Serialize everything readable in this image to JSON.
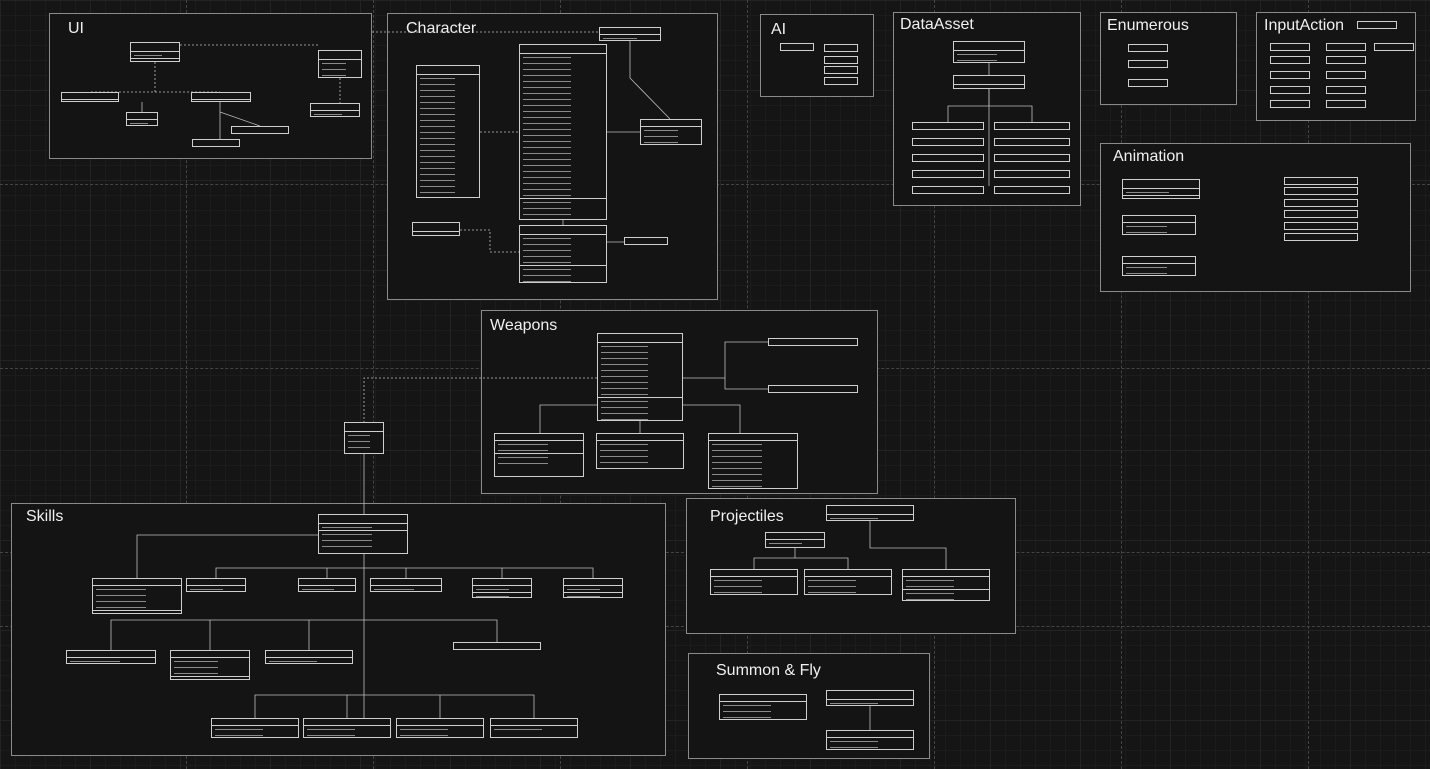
{
  "frames": [
    {
      "id": "ui",
      "title": "UI"
    },
    {
      "id": "character",
      "title": "Character"
    },
    {
      "id": "ai",
      "title": "AI"
    },
    {
      "id": "dataasset",
      "title": "DataAsset"
    },
    {
      "id": "enumerous",
      "title": "Enumerous"
    },
    {
      "id": "inputaction",
      "title": "InputAction"
    },
    {
      "id": "animation",
      "title": "Animation"
    },
    {
      "id": "weapons",
      "title": "Weapons"
    },
    {
      "id": "skills",
      "title": "Skills"
    },
    {
      "id": "projectiles",
      "title": "Projectiles"
    },
    {
      "id": "summon",
      "title": "Summon & Fly"
    }
  ],
  "colors": {
    "background": "#151515",
    "frame_border": "#8a8a8a",
    "box_border": "#cfcfcf",
    "text": "#e8e8e8"
  },
  "note": "Class box contents in this screenshot are rendered too small to be legible; boxes are reproduced as unlabeled structure."
}
